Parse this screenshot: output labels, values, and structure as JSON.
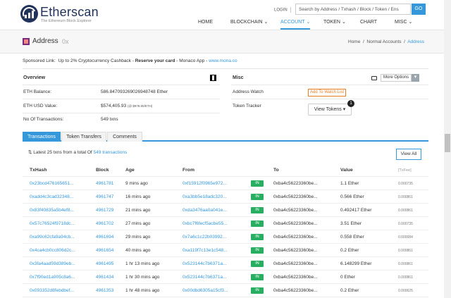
{
  "header": {
    "brand": "Etherscan",
    "tagline": "The Ethereum Block Explorer",
    "login": "LOGIN",
    "search_placeholder": "Search by Address / Txhash / Block / Token / Ens",
    "go": "GO",
    "nav": [
      "HOME",
      "BLOCKCHAIN",
      "ACCOUNT",
      "TOKEN",
      "CHART",
      "MISC"
    ]
  },
  "titlebar": {
    "title": "Address",
    "subtitle": "0x",
    "breadcrumb": [
      "Home",
      "Normal Accounts",
      "Address"
    ]
  },
  "sponsor": {
    "prefix": "Sponsored Link:",
    "text": "Up to 2% Cryptocurrency Cashback -",
    "bold": "Reserve your card",
    "suffix": "- Monaco App -",
    "link": "www.mona.co"
  },
  "overview": {
    "title": "Overview",
    "rows": [
      {
        "label": "ETH Balance:",
        "value": "586.847093269026948748 Ether"
      },
      {
        "label": "ETH USD Value:",
        "value": "$574,405.93",
        "note": "(@ $978.80/ETH)"
      },
      {
        "label": "No Of Transactions:",
        "value": "549 txns"
      }
    ]
  },
  "misc": {
    "title": "Misc",
    "more_options": "More Options",
    "address_watch_label": "Address Watch",
    "add_watch": "Add To Watch List",
    "token_tracker_label": "Token Tracker",
    "view_tokens": "View Tokens",
    "token_count": "1"
  },
  "tabs": [
    "Transactions",
    "Token Transfers",
    "Comments"
  ],
  "txns": {
    "latest_prefix": "Latest 25 txns from a total Of",
    "latest_link": "549 transactions",
    "view_all": "View All",
    "headers": [
      "TxHash",
      "Block",
      "Age",
      "From",
      "",
      "To",
      "Value",
      "[TxFee]"
    ],
    "rows": [
      {
        "hash": "0x23bcd476165651...",
        "block": "4961781",
        "age": "9 mins ago",
        "from": "0xf15912f0965e972...",
        "dir": "IN",
        "to": "0xba4c56223360be...",
        "value": "1.1 Ether",
        "fee": "0.000735"
      },
      {
        "hash": "0xadd4c3cad32348...",
        "block": "4961747",
        "age": "16 mins ago",
        "from": "0xa3bb5e18adc320...",
        "dir": "IN",
        "to": "0xba4c56223360be...",
        "value": "0.566 Ether",
        "fee": "0.000861"
      },
      {
        "hash": "0x83f40835a5b4ef8...",
        "block": "4961729",
        "age": "21 mins ago",
        "from": "0xda3476aa0a041e...",
        "dir": "IN",
        "to": "0xba4c56223360be...",
        "value": "0.492417 Ether",
        "fee": "0.000861"
      },
      {
        "hash": "0x57c76524f9718dc...",
        "block": "4961702",
        "age": "27 mins ago",
        "from": "0xbc7f6fecf5acbe55...",
        "dir": "IN",
        "to": "0xba4c56223360be...",
        "value": "3.51 Ether",
        "fee": "0.000735"
      },
      {
        "hash": "0xa99c62cfa9a94cb...",
        "block": "4961694",
        "age": "29 mins ago",
        "from": "0x7a6c1c22b03992...",
        "dir": "IN",
        "to": "0xba4c56223360be...",
        "value": "0.558 Ether",
        "fee": "0.000084"
      },
      {
        "hash": "0x4ca4cb0cc806d2c...",
        "block": "4961654",
        "age": "40 mins ago",
        "from": "0xa119f7c13e1c548...",
        "dir": "IN",
        "to": "0xba4c56223360be...",
        "value": "0.2 Ether",
        "fee": "0.000861"
      },
      {
        "hash": "0x3fa4aad59d389eb...",
        "block": "4961495",
        "age": "1 hr 13 mins ago",
        "from": "0x523144c7b6371a...",
        "dir": "IN",
        "to": "0xba4c56223360be...",
        "value": "6.148299 Ether",
        "fee": "0.000861"
      },
      {
        "hash": "0x7f90ed1a905c8a6...",
        "block": "4961434",
        "age": "1 hr 30 mins ago",
        "from": "0x523144c7b6371a...",
        "dir": "IN",
        "to": "0xba4c56223360be...",
        "value": "0 Ether",
        "fee": "0.000861"
      },
      {
        "hash": "0x093352d8febdbef...",
        "block": "4961353",
        "age": "1 hr 48 mins ago",
        "from": "0x00dbd6305a15cf3...",
        "dir": "IN",
        "to": "0xba4c56223360be...",
        "value": "0.2 Ether",
        "fee": "0.000625"
      }
    ]
  },
  "colors": {
    "accent": "#3498db",
    "brand": "#21325b",
    "in_badge": "#27ae60",
    "watch": "#e67e22"
  }
}
